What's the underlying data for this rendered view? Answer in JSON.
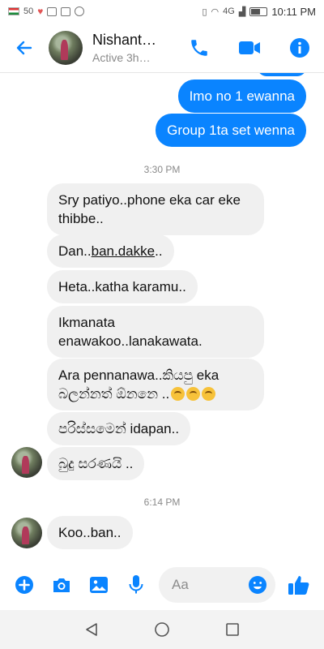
{
  "status_bar": {
    "left_text": "50",
    "signal_label": "4G",
    "time": "10:11 PM"
  },
  "header": {
    "contact_name": "Nishant…",
    "status": "Active 3h…"
  },
  "messages": {
    "out": [
      "Imo no 1 ewanna",
      "Group 1ta set wenna"
    ],
    "timestamp_1": "3:30 PM",
    "in_1": [
      "Sry patiyo..phone eka car eke",
      "thibbe.."
    ],
    "in_2_prefix": "Dan..",
    "in_2_underlined": "ban.dakke",
    "in_2_suffix": "..",
    "in_3": "Heta..katha karamu..",
    "in_4": [
      "Ikmanata",
      "enawakoo..lanakawata."
    ],
    "in_5_line1": "Ara pennanawa..කියපු eka",
    "in_5_line2": "බලන්නත් ඕනනෙ ..",
    "in_6": "පරිස්සමෙන් idapan..",
    "in_7": "බුදු සරණයි ..",
    "timestamp_2": "6:14 PM",
    "in_8": "Koo..ban.."
  },
  "composer": {
    "placeholder": "Aa"
  },
  "colors": {
    "accent": "#0a84ff",
    "incoming_bubble": "#f0f0f0"
  }
}
